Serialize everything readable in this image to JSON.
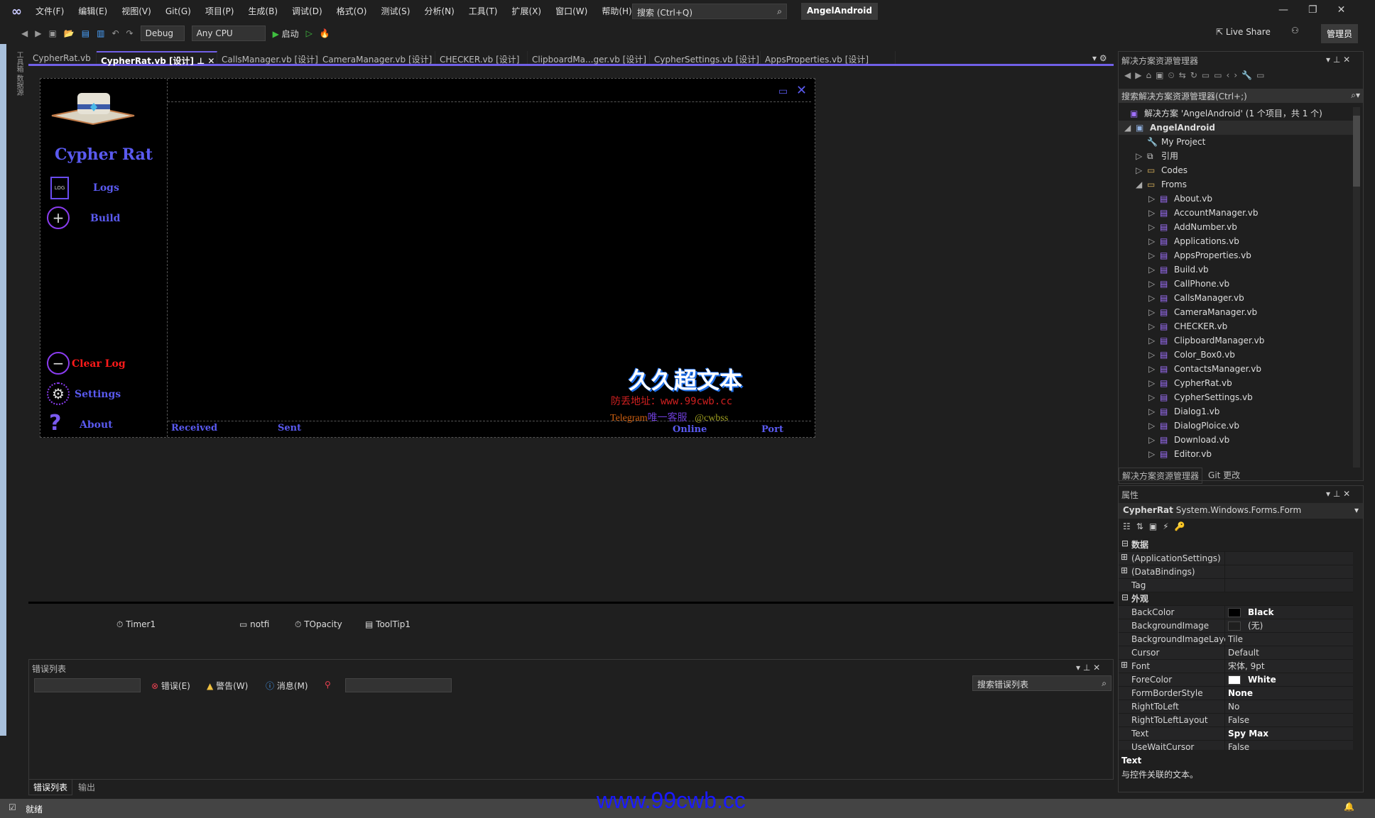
{
  "titlebar": {
    "menu": [
      "文件(F)",
      "编辑(E)",
      "视图(V)",
      "Git(G)",
      "项目(P)",
      "生成(B)",
      "调试(D)",
      "格式(O)",
      "测试(S)",
      "分析(N)",
      "工具(T)",
      "扩展(X)",
      "窗口(W)",
      "帮助(H)"
    ],
    "search_placeholder": "搜索 (Ctrl+Q)",
    "project": "AngelAndroid",
    "live_share": "Live Share",
    "admin": "管理员"
  },
  "toolbar": {
    "config": "Debug",
    "platform": "Any CPU",
    "start": "启动"
  },
  "tabs": [
    {
      "label": "CypherRat.vb"
    },
    {
      "label": "CypherRat.vb [设计]",
      "active": true
    },
    {
      "label": "CallsManager.vb [设计]"
    },
    {
      "label": "CameraManager.vb [设计]"
    },
    {
      "label": "CHECKER.vb [设计]"
    },
    {
      "label": "ClipboardMa...ger.vb [设计]"
    },
    {
      "label": "CypherSettings.vb [设计]"
    },
    {
      "label": "AppsProperties.vb [设计]"
    }
  ],
  "form": {
    "title": "Cypher Rat",
    "nav": {
      "logs": "Logs",
      "build": "Build",
      "clear_log": "Clear Log",
      "settings": "Settings",
      "about": "About"
    },
    "log_icon_text": "LOG",
    "status": {
      "received": "Received",
      "sent": "Sent",
      "online": "Online",
      "port": "Port"
    },
    "watermark": {
      "title": "久久超文本",
      "address": "防丢地址：www.99cwb.cc",
      "telegram": "Telegram",
      "telegram_service": "唯一客服",
      "telegram_handle": "@cwbss"
    }
  },
  "tray": [
    "Timer1",
    "notfi",
    "TOpacity",
    "ToolTip1"
  ],
  "errorlist": {
    "title": "错误列表",
    "errors": "错误(E)",
    "warnings": "警告(W)",
    "messages": "消息(M)",
    "search_placeholder": "搜索错误列表",
    "bottom_tabs": [
      "错误列表",
      "输出"
    ]
  },
  "solution": {
    "title": "解决方案资源管理器",
    "search_placeholder": "搜索解决方案资源管理器(Ctrl+;)",
    "root": "解决方案 'AngelAndroid' (1 个项目，共 1 个)",
    "project": "AngelAndroid",
    "nodes": [
      "My Project",
      "引用",
      "Codes",
      "Froms"
    ],
    "files": [
      "About.vb",
      "AccountManager.vb",
      "AddNumber.vb",
      "Applications.vb",
      "AppsProperties.vb",
      "Build.vb",
      "CallPhone.vb",
      "CallsManager.vb",
      "CameraManager.vb",
      "CHECKER.vb",
      "ClipboardManager.vb",
      "Color_Box0.vb",
      "ContactsManager.vb",
      "CypherRat.vb",
      "CypherSettings.vb",
      "Dialog1.vb",
      "DialogPloice.vb",
      "Download.vb",
      "Editor.vb"
    ],
    "bottom_tabs": [
      "解决方案资源管理器",
      "Git 更改"
    ]
  },
  "properties": {
    "title": "属性",
    "object": "CypherRat",
    "type": "System.Windows.Forms.Form",
    "categories": [
      {
        "name": "数据",
        "rows": [
          {
            "n": "(ApplicationSettings)",
            "v": "",
            "exp": true
          },
          {
            "n": "(DataBindings)",
            "v": "",
            "exp": true
          },
          {
            "n": "Tag",
            "v": ""
          }
        ]
      },
      {
        "name": "外观",
        "rows": [
          {
            "n": "BackColor",
            "v": "Black",
            "swatch": "#000000",
            "bold": true
          },
          {
            "n": "BackgroundImage",
            "v": "(无)",
            "swatch": "#1f1f1f"
          },
          {
            "n": "BackgroundImageLayout",
            "v": "Tile"
          },
          {
            "n": "Cursor",
            "v": "Default"
          },
          {
            "n": "Font",
            "v": "宋体, 9pt",
            "exp": true
          },
          {
            "n": "ForeColor",
            "v": "White",
            "swatch": "#ffffff",
            "bold": true
          },
          {
            "n": "FormBorderStyle",
            "v": "None",
            "bold": true
          },
          {
            "n": "RightToLeft",
            "v": "No"
          },
          {
            "n": "RightToLeftLayout",
            "v": "False"
          },
          {
            "n": "Text",
            "v": "Spy Max",
            "bold": true
          },
          {
            "n": "UseWaitCursor",
            "v": "False"
          }
        ]
      }
    ],
    "desc_title": "Text",
    "desc": "与控件关联的文本。"
  },
  "statusbar": {
    "text": "就绪"
  },
  "page_watermark": "www.99cwb.cc",
  "colors": {
    "accent": "#7160e8",
    "form_label": "#5a5af0",
    "clear_log": "#ff1a1a"
  }
}
